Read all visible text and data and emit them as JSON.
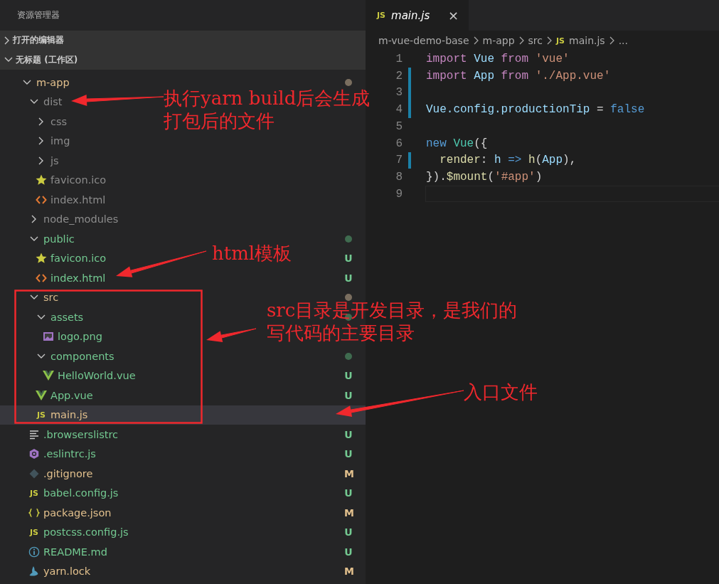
{
  "sidebar": {
    "title": "资源管理器",
    "sections": [
      {
        "label": "打开的编辑器",
        "expanded": false
      },
      {
        "label": "无标题 (工作区)",
        "expanded": true
      }
    ],
    "tree": [
      {
        "name": "m-app",
        "kind": "folder",
        "expanded": true,
        "color": "#e2c08d",
        "dot": {
          "color": "#7a6e5f"
        },
        "selected": false,
        "children": [
          {
            "name": "dist",
            "kind": "folder",
            "expanded": true,
            "color": "#8c8c8c",
            "selected": false,
            "children": [
              {
                "name": "css",
                "kind": "folder",
                "expanded": false,
                "color": "#8c8c8c",
                "selected": false
              },
              {
                "name": "img",
                "kind": "folder",
                "expanded": false,
                "color": "#8c8c8c",
                "selected": false
              },
              {
                "name": "js",
                "kind": "folder",
                "expanded": false,
                "color": "#8c8c8c",
                "selected": false
              },
              {
                "name": "favicon.ico",
                "kind": "ico",
                "color": "#8c8c8c",
                "selected": false
              },
              {
                "name": "index.html",
                "kind": "html",
                "color": "#8c8c8c",
                "selected": false
              }
            ]
          },
          {
            "name": "node_modules",
            "kind": "folder",
            "expanded": false,
            "color": "#8c8c8c",
            "selected": false
          },
          {
            "name": "public",
            "kind": "folder",
            "expanded": true,
            "color": "#73c991",
            "dot": {
              "color": "#3f6b4f"
            },
            "selected": false,
            "children": [
              {
                "name": "favicon.ico",
                "kind": "ico",
                "color": "#73c991",
                "badge": "U",
                "selected": false
              },
              {
                "name": "index.html",
                "kind": "html",
                "color": "#73c991",
                "badge": "U",
                "selected": false
              }
            ]
          },
          {
            "name": "src",
            "kind": "folder",
            "expanded": true,
            "color": "#d7b98a",
            "dot": {
              "color": "#7a6e5f"
            },
            "selected": false,
            "children": [
              {
                "name": "assets",
                "kind": "folder",
                "expanded": true,
                "color": "#73c991",
                "dot": {
                  "color": "#3f6b4f"
                },
                "selected": false,
                "children": [
                  {
                    "name": "logo.png",
                    "kind": "image",
                    "color": "#73c991",
                    "selected": false
                  }
                ]
              },
              {
                "name": "components",
                "kind": "folder",
                "expanded": true,
                "color": "#73c991",
                "dot": {
                  "color": "#3f6b4f"
                },
                "selected": false,
                "children": [
                  {
                    "name": "HelloWorld.vue",
                    "kind": "vue",
                    "color": "#73c991",
                    "badge": "U",
                    "selected": false
                  }
                ]
              },
              {
                "name": "App.vue",
                "kind": "vue",
                "color": "#73c991",
                "badge": "U",
                "selected": false
              },
              {
                "name": "main.js",
                "kind": "js",
                "icon_text": "JS",
                "color": "#e2c08d",
                "selected": true
              }
            ]
          },
          {
            "name": ".browserslistrc",
            "kind": "text",
            "color": "#73c991",
            "badge": "U",
            "selected": false
          },
          {
            "name": ".eslintrc.js",
            "kind": "eslint",
            "color": "#73c991",
            "badge": "U",
            "selected": false
          },
          {
            "name": ".gitignore",
            "kind": "git",
            "color": "#e2c08d",
            "badge": "M",
            "selected": false
          },
          {
            "name": "babel.config.js",
            "kind": "js",
            "icon_text": "JS",
            "color": "#73c991",
            "badge": "U",
            "selected": false
          },
          {
            "name": "package.json",
            "kind": "json",
            "color": "#e2c08d",
            "badge": "M",
            "selected": false
          },
          {
            "name": "postcss.config.js",
            "kind": "js",
            "icon_text": "JS",
            "color": "#73c991",
            "badge": "U",
            "selected": false
          },
          {
            "name": "README.md",
            "kind": "info",
            "color": "#73c991",
            "badge": "U",
            "selected": false
          },
          {
            "name": "yarn.lock",
            "kind": "yarn",
            "color": "#e2c08d",
            "badge": "M",
            "selected": false
          }
        ]
      }
    ]
  },
  "editor": {
    "tabs": [
      {
        "label": "main.js",
        "icon_text": "JS",
        "close": "×",
        "selected": true
      }
    ],
    "breadcrumb": [
      {
        "label": "m-vue-demo-base"
      },
      {
        "label": "m-app"
      },
      {
        "label": "src"
      },
      {
        "label": "main.js",
        "icon_text": "JS"
      },
      {
        "label": "..."
      }
    ],
    "lines": [
      {
        "number": "1",
        "changed": false,
        "tokens": [
          {
            "text": "import",
            "kind": "keyword"
          },
          {
            "text": " Vue",
            "kind": "variable"
          },
          {
            "text": " from",
            "kind": "keyword"
          },
          {
            "text": " 'vue'",
            "kind": "string"
          }
        ]
      },
      {
        "number": "2",
        "changed": true,
        "tokens": [
          {
            "text": "import",
            "kind": "keyword"
          },
          {
            "text": " App",
            "kind": "variable"
          },
          {
            "text": " from",
            "kind": "keyword"
          },
          {
            "text": " './App.vue'",
            "kind": "string"
          }
        ]
      },
      {
        "number": "3",
        "changed": true
      },
      {
        "number": "4",
        "changed": true,
        "tokens": [
          {
            "text": "Vue.config.productionTip",
            "kind": "variable"
          },
          {
            "text": " = ",
            "kind": "plain"
          },
          {
            "text": "false",
            "kind": "constant"
          }
        ]
      },
      {
        "number": "5",
        "changed": false
      },
      {
        "number": "6",
        "changed": false,
        "tokens": [
          {
            "text": "new",
            "kind": "constant"
          },
          {
            "text": " Vue",
            "kind": "class"
          },
          {
            "text": "({",
            "kind": "plain"
          }
        ]
      },
      {
        "number": "7",
        "changed": true,
        "tokens": [
          {
            "text": "  render",
            "kind": "function"
          },
          {
            "text": ": ",
            "kind": "plain"
          },
          {
            "text": "h",
            "kind": "variable"
          },
          {
            "text": " =>",
            "kind": "constant"
          },
          {
            "text": " h",
            "kind": "function"
          },
          {
            "text": "(",
            "kind": "plain"
          },
          {
            "text": "App",
            "kind": "variable"
          },
          {
            "text": "),",
            "kind": "plain"
          }
        ]
      },
      {
        "number": "8",
        "changed": false,
        "tokens": [
          {
            "text": "}).",
            "kind": "plain"
          },
          {
            "text": "$mount",
            "kind": "function"
          },
          {
            "text": "(",
            "kind": "plain"
          },
          {
            "text": "'#app'",
            "kind": "string"
          },
          {
            "text": ")",
            "kind": "plain"
          }
        ]
      },
      {
        "number": "9",
        "changed": false,
        "current": true
      }
    ]
  },
  "annotations": [
    {
      "lines": [
        "执行yarn build后会生成",
        "打包后的文件"
      ]
    },
    {
      "lines": [
        "html模板"
      ]
    },
    {
      "lines": [
        "src目录是开发目录，是我们的",
        "写代码的主要目录"
      ]
    },
    {
      "lines": [
        "入口文件"
      ]
    }
  ]
}
